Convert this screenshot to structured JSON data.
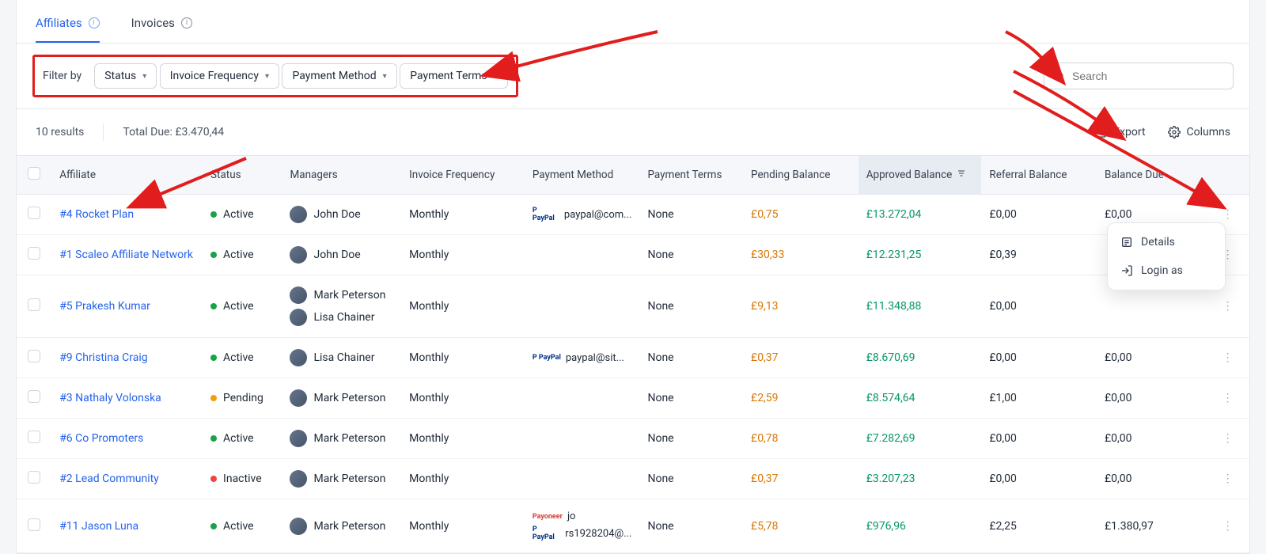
{
  "tabs": [
    {
      "label": "Affiliates",
      "active": true
    },
    {
      "label": "Invoices",
      "active": false
    }
  ],
  "filters": {
    "label": "Filter by",
    "items": [
      "Status",
      "Invoice Frequency",
      "Payment Method",
      "Payment Terms"
    ]
  },
  "search": {
    "placeholder": "Search"
  },
  "meta": {
    "results": "10 results",
    "total_due": "Total Due: £3.470,44",
    "export": "Export",
    "columns": "Columns"
  },
  "columns": [
    "Affiliate",
    "Status",
    "Managers",
    "Invoice Frequency",
    "Payment Method",
    "Payment Terms",
    "Pending Balance",
    "Approved Balance",
    "Referral Balance",
    "Balance Due"
  ],
  "sorted_column_index": 7,
  "status_colors": {
    "Active": "#16a34a",
    "Pending": "#f59e0b",
    "Inactive": "#ef4444"
  },
  "rows": [
    {
      "affiliate": "#4 Rocket Plan",
      "status": "Active",
      "managers": [
        "John Doe"
      ],
      "frequency": "Monthly",
      "payment": [
        {
          "brand": "paypal",
          "text": "paypal@com..."
        }
      ],
      "terms": "None",
      "pending": "£0,75",
      "approved": "£13.272,04",
      "referral": "£0,00",
      "due": "£0,00",
      "menu_open": true
    },
    {
      "affiliate": "#1 Scaleo Affiliate Network",
      "status": "Active",
      "managers": [
        "John Doe"
      ],
      "frequency": "Monthly",
      "payment": [],
      "terms": "None",
      "pending": "£30,33",
      "approved": "£12.231,25",
      "referral": "£0,39",
      "due": ""
    },
    {
      "affiliate": "#5 Prakesh Kumar",
      "status": "Active",
      "managers": [
        "Mark Peterson",
        "Lisa Chainer"
      ],
      "frequency": "Monthly",
      "payment": [],
      "terms": "None",
      "pending": "£9,13",
      "approved": "£11.348,88",
      "referral": "£0,00",
      "due": ""
    },
    {
      "affiliate": "#9 Christina Craig",
      "status": "Active",
      "managers": [
        "Lisa Chainer"
      ],
      "frequency": "Monthly",
      "payment": [
        {
          "brand": "paypal",
          "text": "paypal@sit..."
        }
      ],
      "terms": "None",
      "pending": "£0,37",
      "approved": "£8.670,69",
      "referral": "£0,00",
      "due": "£0,00"
    },
    {
      "affiliate": "#3 Nathaly Volonska",
      "status": "Pending",
      "managers": [
        "Mark Peterson"
      ],
      "frequency": "Monthly",
      "payment": [],
      "terms": "None",
      "pending": "£2,59",
      "approved": "£8.574,64",
      "referral": "£1,00",
      "due": "£0,00"
    },
    {
      "affiliate": "#6 Co Promoters",
      "status": "Active",
      "managers": [
        "Mark Peterson"
      ],
      "frequency": "Monthly",
      "payment": [],
      "terms": "None",
      "pending": "£0,78",
      "approved": "£7.282,69",
      "referral": "£0,00",
      "due": "£0,00"
    },
    {
      "affiliate": "#2 Lead Community",
      "status": "Inactive",
      "managers": [
        "Mark Peterson"
      ],
      "frequency": "Monthly",
      "payment": [],
      "terms": "None",
      "pending": "£0,37",
      "approved": "£3.207,23",
      "referral": "£0,00",
      "due": "£0,00"
    },
    {
      "affiliate": "#11 Jason Luna",
      "status": "Active",
      "managers": [
        "Mark Peterson"
      ],
      "frequency": "Monthly",
      "payment": [
        {
          "brand": "payoneer",
          "text": "jo"
        },
        {
          "brand": "paypal",
          "text": "rs1928204@..."
        }
      ],
      "terms": "None",
      "pending": "£5,78",
      "approved": "£976,96",
      "referral": "£2,25",
      "due": "£1.380,97"
    }
  ],
  "row_menu": {
    "details": "Details",
    "login_as": "Login as"
  }
}
